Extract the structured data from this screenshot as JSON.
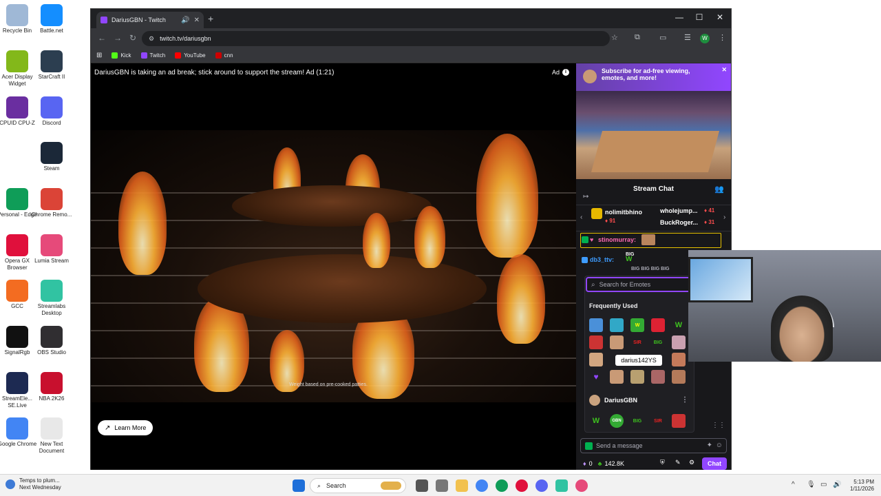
{
  "desktop": {
    "icons": [
      {
        "label": "Recycle Bin",
        "icon": "recycle-bin-icon",
        "color": "#9fb8d6"
      },
      {
        "label": "Battle.net",
        "icon": "battlenet-icon",
        "color": "#148eff"
      },
      {
        "label": "Acer Display Widget",
        "icon": "acer-icon",
        "color": "#83b81a"
      },
      {
        "label": "StarCraft II",
        "icon": "starcraft-icon",
        "color": "#2c3e50"
      },
      {
        "label": "CPUID CPU-Z",
        "icon": "cpuz-icon",
        "color": "#6a2ea0"
      },
      {
        "label": "Discord",
        "icon": "discord-icon",
        "color": "#5865f2"
      },
      {
        "label": "Steam",
        "icon": "steam-icon",
        "color": "#1b2838"
      },
      {
        "label": "Personal - Edge",
        "icon": "edge-icon",
        "color": "#0f9d58"
      },
      {
        "label": "Chrome Remo...",
        "icon": "chrome-remote-icon",
        "color": "#db4437"
      },
      {
        "label": "Opera GX Browser",
        "icon": "opera-icon",
        "color": "#e0103c"
      },
      {
        "label": "Lumia Stream",
        "icon": "lumia-icon",
        "color": "#e64a7a"
      },
      {
        "label": "GCC",
        "icon": "gcc-icon",
        "color": "#f36c21"
      },
      {
        "label": "Streamlabs Desktop",
        "icon": "streamlabs-icon",
        "color": "#31c3a2"
      },
      {
        "label": "SignalRgb",
        "icon": "signalrgb-icon",
        "color": "#111111"
      },
      {
        "label": "OBS Studio",
        "icon": "obs-icon",
        "color": "#302e31"
      },
      {
        "label": "StreamEle... SE.Live",
        "icon": "streamelements-icon",
        "color": "#1d2a52"
      },
      {
        "label": "NBA 2K26",
        "icon": "nba2k-icon",
        "color": "#c8102e"
      },
      {
        "label": "Google Chrome",
        "icon": "chrome-icon",
        "color": "#4285f4"
      },
      {
        "label": "New Text Document",
        "icon": "text-document-icon",
        "color": "#e8e8e8"
      }
    ]
  },
  "browser": {
    "tab_title": "DariusGBN - Twitch",
    "url": "twitch.tv/dariusgbn",
    "profile_initial": "W",
    "bookmarks": [
      {
        "label": "Kick",
        "color": "#53fc18"
      },
      {
        "label": "Twitch",
        "color": "#9146ff"
      },
      {
        "label": "YouTube",
        "color": "#ff0000"
      },
      {
        "label": "cnn",
        "color": "#cc0000"
      }
    ]
  },
  "player": {
    "ad_message": "DariusGBN is taking an ad break; stick around to support the stream! Ad (1:21)",
    "ad_label": "Ad",
    "ad_info": "i",
    "weight_note": "Weight based on pre-cooked patties.",
    "learn_more": "Learn More"
  },
  "side": {
    "promo_line1": "Subscribe for ad-free viewing,",
    "promo_line2": "emotes, and more!",
    "chat_title": "Stream Chat",
    "leaderboard": [
      {
        "name": "nolimitbhino",
        "bits": "91"
      },
      {
        "name": "wholejump...",
        "bits": "41"
      },
      {
        "name": "BuckRoger...",
        "bits": "31"
      }
    ],
    "messages": [
      {
        "user": "stinomurray:",
        "color": "#ff69b4"
      },
      {
        "user": "db3_ttv:",
        "color": "#3e9cff"
      }
    ],
    "big_text": "BIG BIG BIG BIG",
    "emote_search_placeholder": "Search for Emotes",
    "frequently_used": "Frequently Used",
    "tooltip": "darius142YS",
    "channel_name": "DariusGBN",
    "emote_labels": {
      "w": "W",
      "big": "BIG",
      "sir": "SIR",
      "gbn": "GBN"
    },
    "chat_placeholder": "Send a message",
    "points": "0",
    "bits_total": "142.8K",
    "chat_button": "Chat"
  },
  "taskbar": {
    "weather_line1": "Temps to plum...",
    "weather_line2": "Next Wednesday",
    "search_label": "Search",
    "time": "5:13 PM",
    "date": "1/11/2026"
  }
}
